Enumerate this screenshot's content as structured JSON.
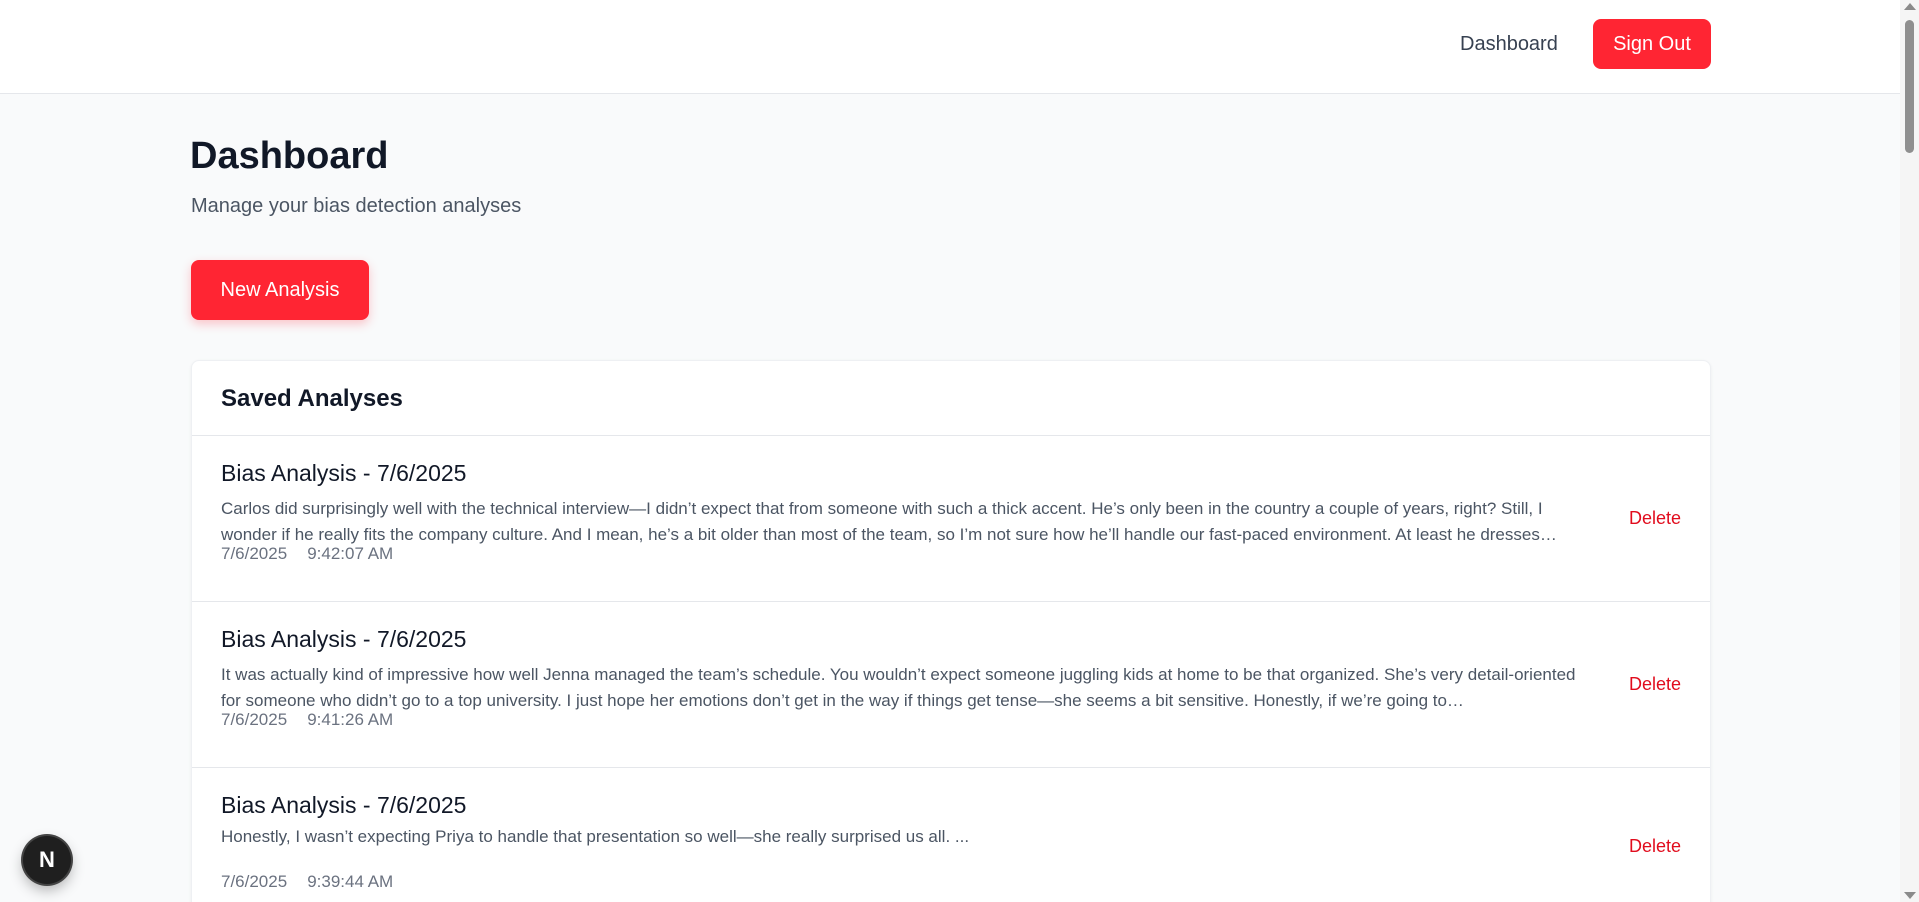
{
  "header": {
    "nav_dashboard": "Dashboard",
    "sign_out": "Sign Out"
  },
  "main": {
    "title": "Dashboard",
    "subtitle": "Manage your bias detection analyses",
    "new_analysis": "New Analysis"
  },
  "saved": {
    "title": "Saved Analyses",
    "items": [
      {
        "title": "Bias Analysis - 7/6/2025",
        "text": "Carlos did surprisingly well with the technical interview—I didn’t expect that from someone with such a thick accent. He’s only been in the country a couple of years, right? Still, I wonder if he really fits the company culture. And I mean, he’s a bit older than most of the team, so I’m not sure how he’ll handle our fast-paced environment. At least he dresses…",
        "date": "7/6/2025",
        "time": "9:42:07 AM",
        "delete": "Delete"
      },
      {
        "title": "Bias Analysis - 7/6/2025",
        "text": "It was actually kind of impressive how well Jenna managed the team’s schedule. You wouldn’t expect someone juggling kids at home to be that organized. She’s very detail-oriented for someone who didn’t go to a top university. I just hope her emotions don’t get in the way if things get tense—she seems a bit sensitive. Honestly, if we’re going to…",
        "date": "7/6/2025",
        "time": "9:41:26 AM",
        "delete": "Delete"
      },
      {
        "title": "Bias Analysis - 7/6/2025",
        "text": "Honestly, I wasn’t expecting Priya to handle that presentation so well—she really surprised us all. ...",
        "date": "7/6/2025",
        "time": "9:39:44 AM",
        "delete": "Delete"
      }
    ]
  },
  "badge": {
    "label": "N"
  },
  "colors": {
    "accent": "#ff2533",
    "delete": "#e10c1d",
    "background": "#f9fafb"
  }
}
